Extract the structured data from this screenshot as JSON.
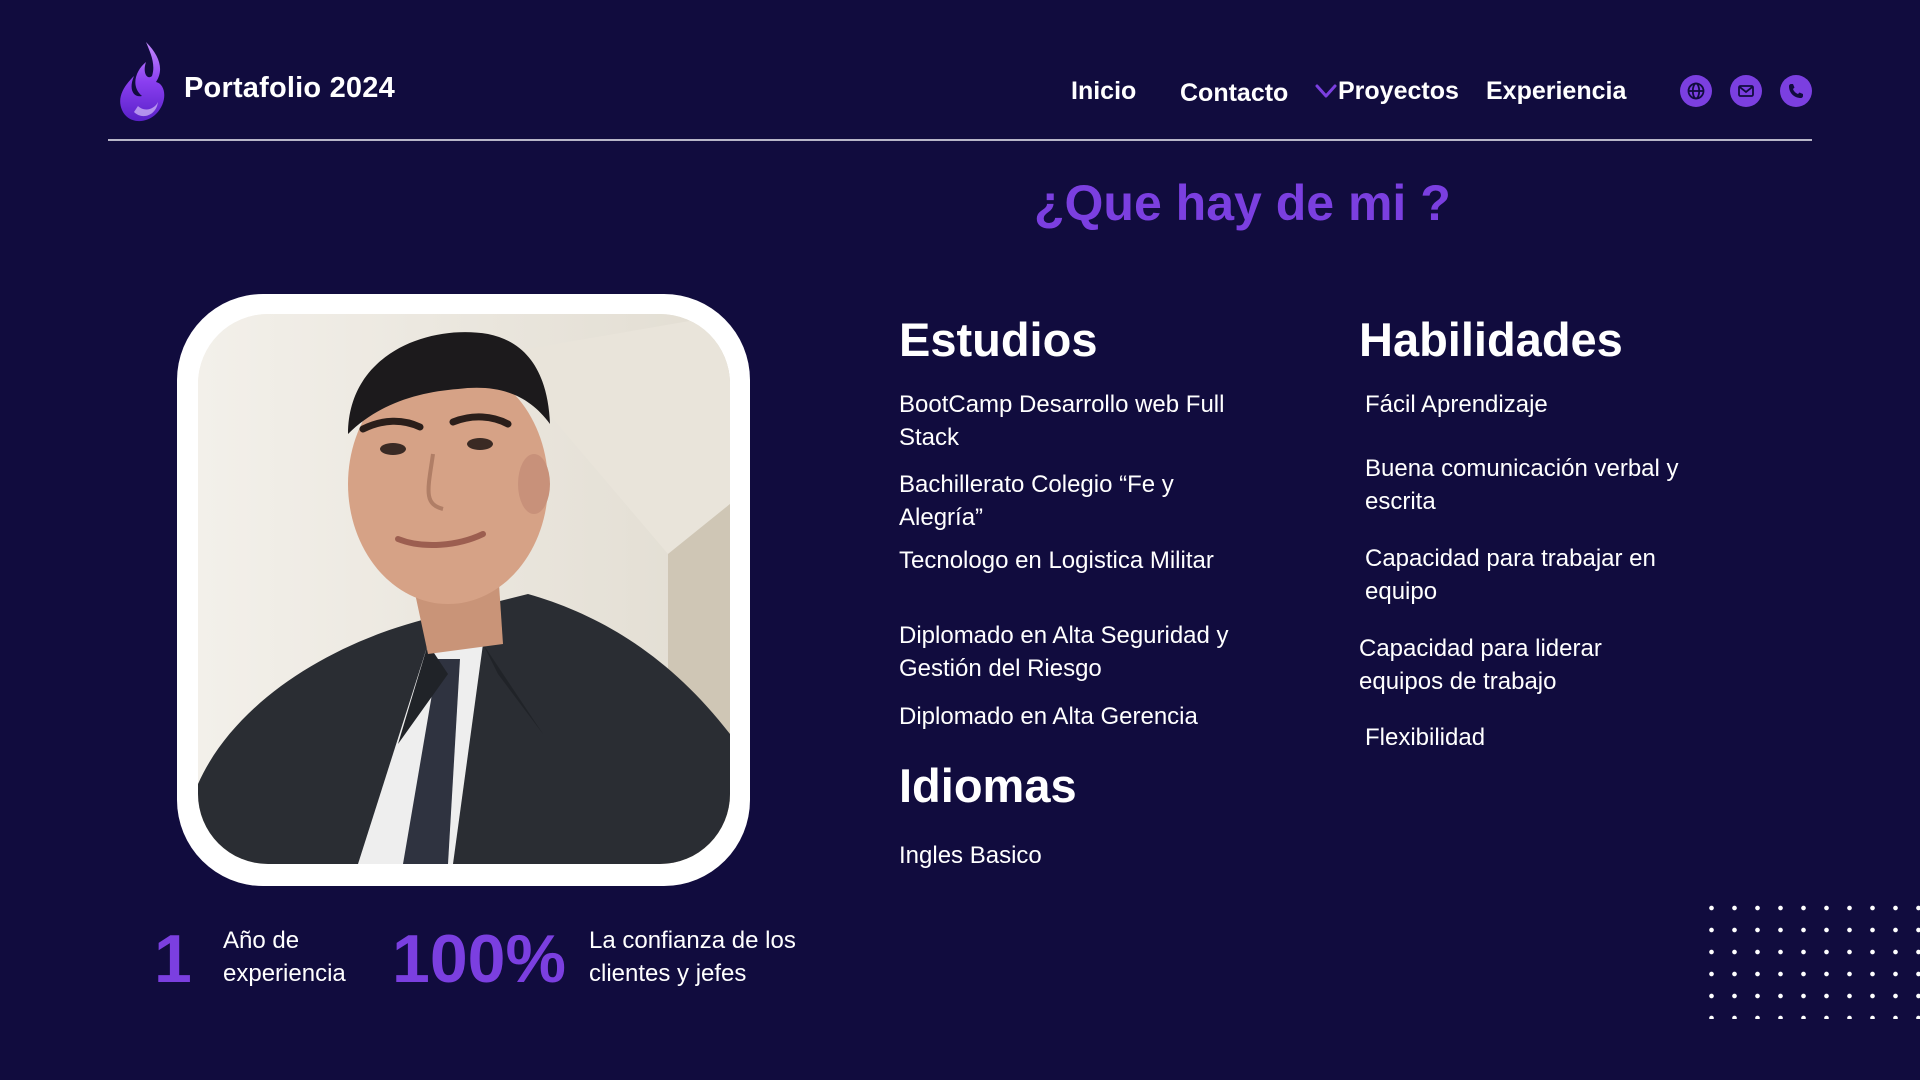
{
  "header": {
    "brand": "Portafolio 2024",
    "nav": {
      "inicio": "Inicio",
      "contacto": "Contacto",
      "proyectos": "Proyectos",
      "experiencia": "Experiencia"
    },
    "icons": [
      "globe-icon",
      "mail-icon",
      "phone-icon"
    ]
  },
  "headline": "¿Que hay de mi ?",
  "estudios": {
    "title": "Estudios",
    "items": [
      "BootCamp Desarrollo web Full Stack",
      "Bachillerato Colegio “Fe y Alegría”",
      "Tecnologo en Logistica Militar",
      "Diplomado en Alta Seguridad y Gestión del Riesgo",
      "Diplomado en Alta Gerencia"
    ]
  },
  "idiomas": {
    "title": "Idiomas",
    "items": [
      "Ingles Basico"
    ]
  },
  "habilidades": {
    "title": "Habilidades",
    "items": [
      "Fácil Aprendizaje",
      "Buena comunicación verbal y escrita",
      "Capacidad para trabajar en equipo",
      "Capacidad para liderar equipos de trabajo",
      "Flexibilidad"
    ]
  },
  "stats": [
    {
      "value": "1",
      "label": "Año de experiencia"
    },
    {
      "value": "100%",
      "label": "La confianza de los clientes y jefes"
    }
  ],
  "colors": {
    "background": "#110c3e",
    "accent": "#7b3fe0",
    "text": "#ffffff"
  }
}
